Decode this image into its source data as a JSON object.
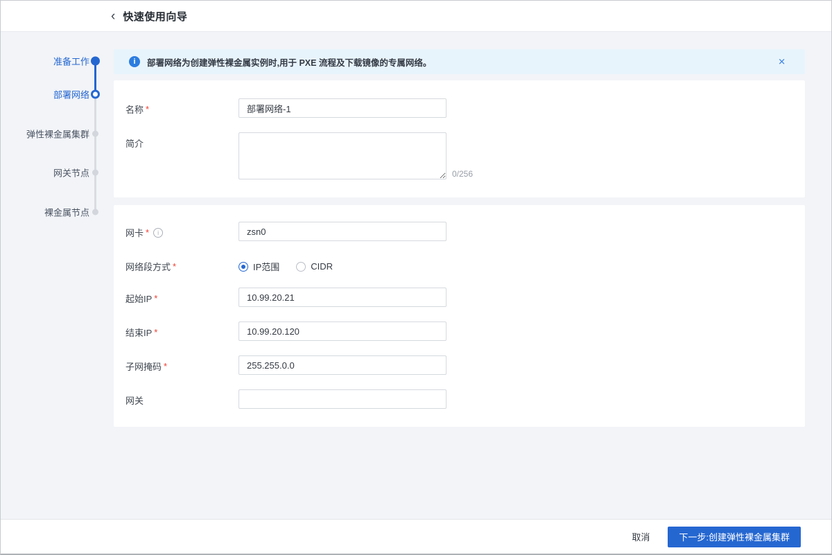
{
  "colors": {
    "accent": "#2567d1",
    "banner_bg": "#e8f4fc",
    "page_bg": "#f2f4f8",
    "required_red": "#f04134"
  },
  "header": {
    "back_icon": "‹",
    "title": "快速使用向导"
  },
  "steps": {
    "items": [
      {
        "label": "准备工作",
        "state": "done"
      },
      {
        "label": "部署网络",
        "state": "current"
      },
      {
        "label": "弹性裸金属集群",
        "state": "pending"
      },
      {
        "label": "网关节点",
        "state": "pending"
      },
      {
        "label": "裸金属节点",
        "state": "pending"
      }
    ]
  },
  "banner": {
    "icon": "i",
    "text": "部署网络为创建弹性裸金属实例时,用于 PXE 流程及下载镜像的专属网络。",
    "close_icon": "✕"
  },
  "form": {
    "required_mark": "*",
    "name": {
      "label": "名称",
      "value": "部署网络-1"
    },
    "description": {
      "label": "简介",
      "value": "",
      "counter": "0/256"
    },
    "nic": {
      "label": "网卡",
      "help_icon": "i",
      "value": "zsn0"
    },
    "segment_mode": {
      "label": "网络段方式",
      "options": [
        {
          "label": "IP范围",
          "selected": true
        },
        {
          "label": "CIDR",
          "selected": false
        }
      ]
    },
    "start_ip": {
      "label": "起始IP",
      "value": "10.99.20.21"
    },
    "end_ip": {
      "label": "结束IP",
      "value": "10.99.20.120"
    },
    "netmask": {
      "label": "子网掩码",
      "value": "255.255.0.0"
    },
    "gateway": {
      "label": "网关",
      "value": ""
    }
  },
  "footer": {
    "cancel_label": "取消",
    "next_label": "下一步:创建弹性裸金属集群"
  }
}
